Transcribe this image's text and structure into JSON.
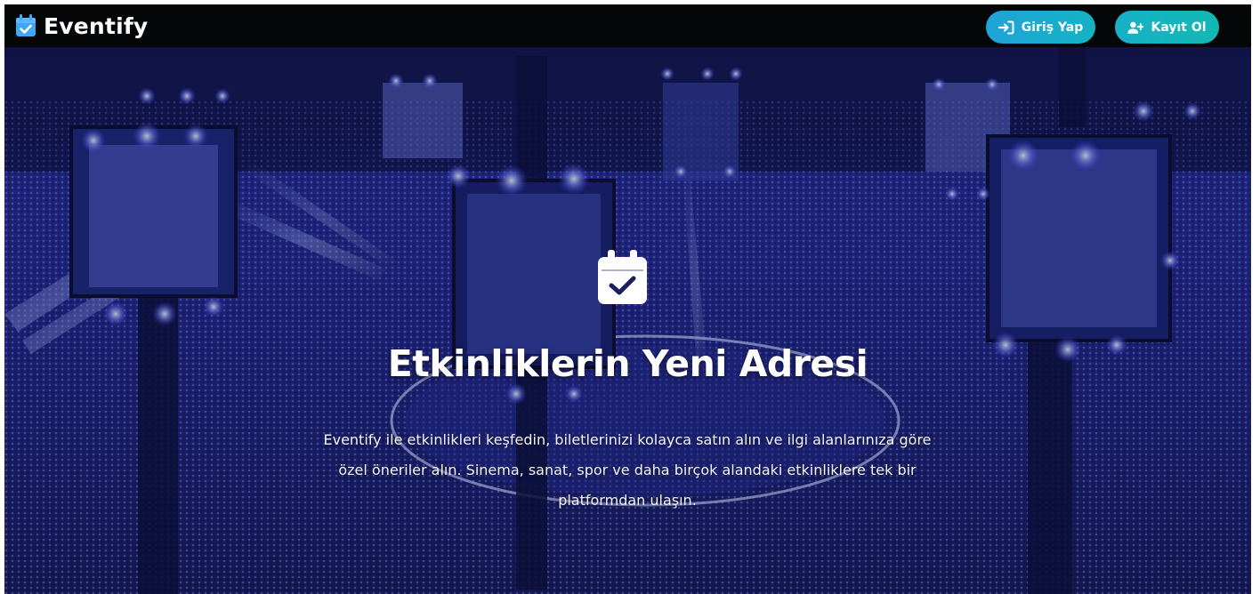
{
  "navbar": {
    "brand": "Eventify",
    "brand_icon": "calendar-check-icon",
    "login_label": "Giriş Yap",
    "login_icon": "sign-in-icon",
    "register_label": "Kayıt Ol",
    "register_icon": "user-plus-icon"
  },
  "hero": {
    "icon": "calendar-check-icon",
    "title": "Etkinliklerin Yeni Adresi",
    "description": "Eventify ile etkinlikleri keşfedin, biletlerinizi kolayca satın alın ve ilgi alanlarınıza göre özel öneriler alın. Sinema, sanat, spor ve daha birçok alandaki etkinliklere tek bir platformdan ulaşın."
  },
  "colors": {
    "navbar_bg": "#050608",
    "button_gradient_start": "#1fa3d8",
    "button_gradient_end": "#14b3c4",
    "hero_overlay": "#1a1f8a",
    "text": "#ffffff"
  }
}
